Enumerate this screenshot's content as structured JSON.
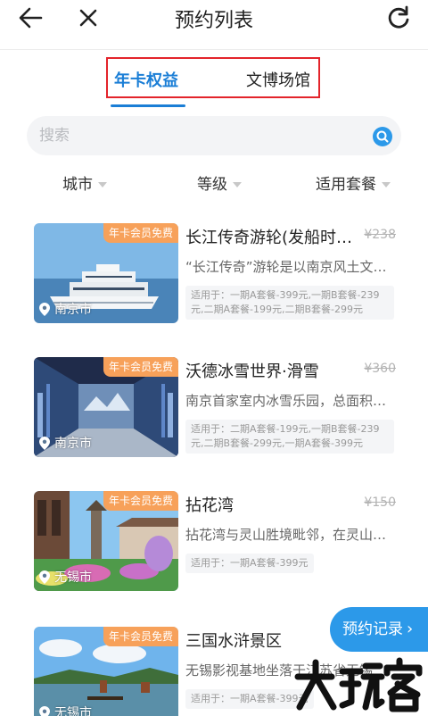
{
  "header": {
    "title": "预约列表",
    "back_icon": "arrow-left-icon",
    "close_icon": "close-icon",
    "refresh_icon": "refresh-icon"
  },
  "tabs": [
    {
      "label": "年卡权益",
      "active": true
    },
    {
      "label": "文博场馆",
      "active": false
    }
  ],
  "search": {
    "placeholder": "搜索",
    "icon": "search-icon"
  },
  "filters": [
    {
      "label": "城市"
    },
    {
      "label": "等级"
    },
    {
      "label": "适用套餐"
    }
  ],
  "cards": [
    {
      "badge": "年卡会员免费",
      "city": "南京市",
      "title": "长江传奇游轮(发船时…",
      "price": "¥238",
      "desc": "“长江传奇”游轮是以南京风土文…",
      "applies": "适用于：一期A套餐-399元,一期B套餐-239元,二期A套餐-199元,二期B套餐-299元"
    },
    {
      "badge": "年卡会员免费",
      "city": "南京市",
      "title": "沃德冰雪世界·滑雪",
      "price": "¥360",
      "desc": "南京首家室内冰雪乐园，总面积…",
      "applies": "适用于：二期A套餐-199元,一期B套餐-239元,二期B套餐-299元,一期A套餐-399元"
    },
    {
      "badge": "年卡会员免费",
      "city": "无锡市",
      "title": "拈花湾",
      "price": "¥150",
      "desc": "拈花湾与灵山胜境毗邻，在灵山…",
      "applies": "适用于：一期A套餐-399元"
    },
    {
      "badge": "年卡会员免费",
      "city": "无锡市",
      "title": "三国水浒景区",
      "price": "",
      "desc": "无锡影视基地坐落于江苏省无锡",
      "applies": "适用于：一期A套餐-399元"
    }
  ],
  "fab": {
    "label": "预约记录",
    "chevron": "›"
  },
  "watermark": {
    "text": "大玩客"
  },
  "colors": {
    "accent": "#1a7ed6",
    "badge": "#f7a15a",
    "highlight_frame": "#e3242b",
    "fab": "#2c99e9"
  }
}
